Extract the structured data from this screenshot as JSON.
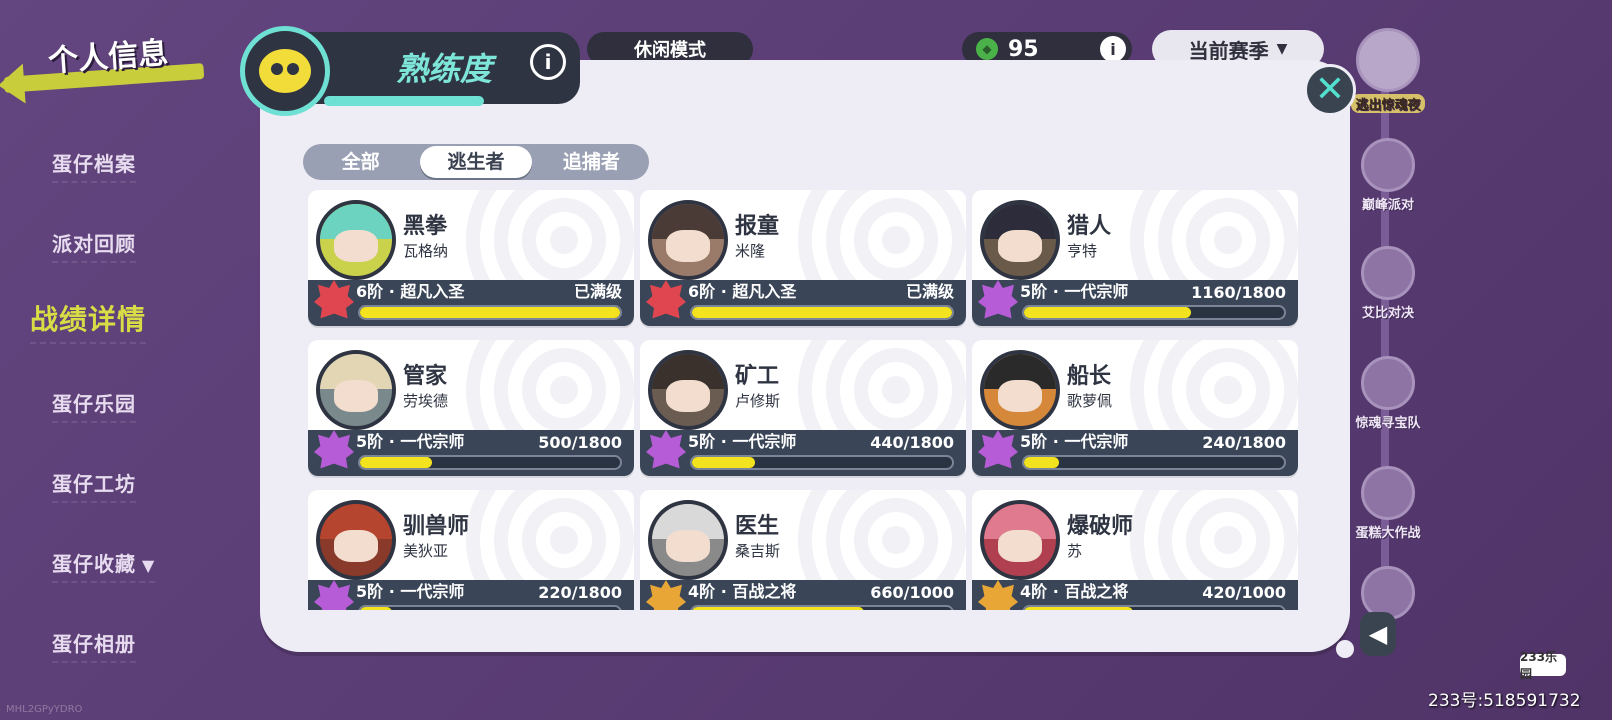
{
  "nav": {
    "back_title": "个人信息",
    "items": [
      {
        "label": "蛋仔档案"
      },
      {
        "label": "派对回顾"
      },
      {
        "label": "战绩详情",
        "active": true
      },
      {
        "label": "蛋仔乐园"
      },
      {
        "label": "蛋仔工坊"
      },
      {
        "label": "蛋仔收藏",
        "chevron": "▼"
      },
      {
        "label": "蛋仔相册"
      }
    ]
  },
  "topbar": {
    "mode": "休闲模式",
    "score": "95",
    "score_icon": "gem-icon",
    "info_glyph": "i",
    "season": "当前赛季",
    "season_chevron": "▼"
  },
  "events": [
    {
      "label": "逃出惊魂夜"
    },
    {
      "label": "巅峰派对"
    },
    {
      "label": "艾比对决"
    },
    {
      "label": "惊魂寻宝队"
    },
    {
      "label": "蛋糕大作战"
    },
    {
      "label": ""
    }
  ],
  "panel": {
    "title": "熟练度",
    "info_glyph": "i",
    "close_glyph": "✕",
    "collapse_glyph": "◀",
    "tabs": [
      {
        "label": "全部",
        "selected": false
      },
      {
        "label": "逃生者",
        "selected": true
      },
      {
        "label": "追捕者",
        "selected": false
      }
    ],
    "cards": [
      {
        "name": "黑拳",
        "player": "瓦格纳",
        "rank": "6阶 · 超凡入圣",
        "progress_text": "已满级",
        "progress": 1.0,
        "rank_color": "#e0464f",
        "hair": "#6bd3c0",
        "ring": "#c9d24a"
      },
      {
        "name": "报童",
        "player": "米隆",
        "rank": "6阶 · 超凡入圣",
        "progress_text": "已满级",
        "progress": 1.0,
        "rank_color": "#e0464f",
        "hair": "#4a3b36",
        "ring": "#9a7b6a"
      },
      {
        "name": "猎人",
        "player": "亨特",
        "rank": "5阶 · 一代宗师",
        "progress_text": "1160/1800",
        "progress": 0.644,
        "rank_color": "#b65cd6",
        "hair": "#2c2c3a",
        "ring": "#6a5a4a"
      },
      {
        "name": "管家",
        "player": "劳埃德",
        "rank": "5阶 · 一代宗师",
        "progress_text": "500/1800",
        "progress": 0.278,
        "rank_color": "#b65cd6",
        "hair": "#e3d6b4",
        "ring": "#7a8a8c"
      },
      {
        "name": "矿工",
        "player": "卢修斯",
        "rank": "5阶 · 一代宗师",
        "progress_text": "440/1800",
        "progress": 0.244,
        "rank_color": "#b65cd6",
        "hair": "#3a302c",
        "ring": "#6a5c50"
      },
      {
        "name": "船长",
        "player": "歌萝佩",
        "rank": "5阶 · 一代宗师",
        "progress_text": "240/1800",
        "progress": 0.133,
        "rank_color": "#b65cd6",
        "hair": "#2a2a2a",
        "ring": "#d6883a"
      },
      {
        "name": "驯兽师",
        "player": "美狄亚",
        "rank": "5阶 · 一代宗师",
        "progress_text": "220/1800",
        "progress": 0.122,
        "rank_color": "#b65cd6",
        "hair": "#b5452e",
        "ring": "#8a3a2a"
      },
      {
        "name": "医生",
        "player": "桑吉斯",
        "rank": "4阶 · 百战之将",
        "progress_text": "660/1000",
        "progress": 0.66,
        "rank_color": "#e8a637",
        "hair": "#d9d9d9",
        "ring": "#8a8a8a"
      },
      {
        "name": "爆破师",
        "player": "苏",
        "rank": "4阶 · 百战之将",
        "progress_text": "420/1000",
        "progress": 0.42,
        "rank_color": "#e8a637",
        "hair": "#e07a8e",
        "ring": "#b04050"
      }
    ]
  },
  "footer": {
    "badge": "233乐园",
    "id_text": "233号:518591732",
    "watermark": "MHL2GPyYDRO"
  }
}
